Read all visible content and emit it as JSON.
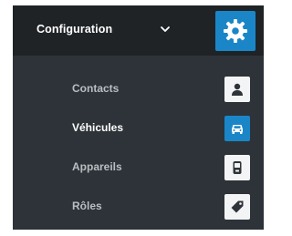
{
  "header": {
    "title": "Configuration",
    "chevron_icon": "chevron-down-icon",
    "action_icon": "gear-icon"
  },
  "menu": {
    "items": [
      {
        "label": "Contacts",
        "icon": "person-icon",
        "active": false
      },
      {
        "label": "Véhicules",
        "icon": "car-icon",
        "active": true
      },
      {
        "label": "Appareils",
        "icon": "device-icon",
        "active": false
      },
      {
        "label": "Rôles",
        "icon": "tag-icon",
        "active": false
      }
    ]
  },
  "colors": {
    "panel_bg": "#2d3338",
    "header_bg": "#1f2326",
    "accent": "#1a86c7",
    "inactive_text": "#b9bec3",
    "active_text": "#ffffff",
    "icon_tile": "#f3f4f5",
    "icon_glyph": "#2d3338"
  }
}
